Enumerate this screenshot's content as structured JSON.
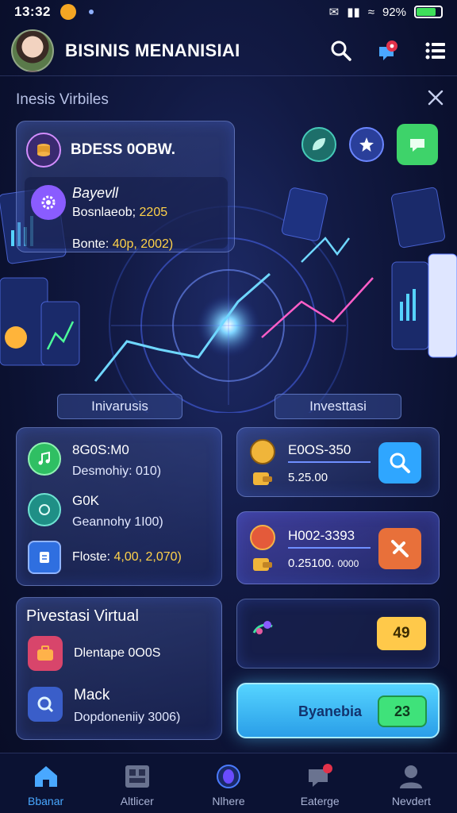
{
  "status_bar": {
    "time": "13:32",
    "battery": "92%"
  },
  "header": {
    "title": "BISINIS MENANISIAI"
  },
  "subheader": {
    "label": "Inesis Virbiles"
  },
  "top_card": {
    "title": "BDESS 0OBW.",
    "name": "Bayevll",
    "line1_prefix": "Bosnlaeob;",
    "line1_value": "2205",
    "line2_prefix": "Bonte:",
    "line2_value": "40p, 2002)"
  },
  "pills": {
    "left": "Inivarusis",
    "right": "Investtasi"
  },
  "list_card": {
    "items": [
      {
        "title": "8G0S:M0",
        "sub": "Desmohiy: 010)"
      },
      {
        "title": "G0K",
        "sub": "Geannohy 1I00)"
      },
      {
        "title": "Floste:",
        "sub_value": "4,00, 2,070)"
      }
    ]
  },
  "right_cards": [
    {
      "code": "E0OS-350",
      "value": "5.25.00"
    },
    {
      "code": "H002-3393",
      "value": "0.25100.",
      "value_extra": "0000"
    }
  ],
  "score_card": {
    "value": "49"
  },
  "virtual_card": {
    "title": "Pivestasi Virtual",
    "items": [
      {
        "label": "Dlentape 0O0S"
      },
      {
        "label": "Mack",
        "sub": "Dopdoneniiy 3006)"
      }
    ]
  },
  "cta": {
    "label": "Byanebia",
    "value": "23"
  },
  "bottom_nav": [
    {
      "label": "Bbanar",
      "icon": "home-icon",
      "active": true
    },
    {
      "label": "Altlicer",
      "icon": "grid-icon",
      "active": false
    },
    {
      "label": "Nlhere",
      "icon": "orb-icon",
      "active": false
    },
    {
      "label": "Eaterge",
      "icon": "chat-icon",
      "active": false
    },
    {
      "label": "Nevdert",
      "icon": "user-icon",
      "active": false
    }
  ],
  "colors": {
    "accent": "#49a8ff",
    "gold": "#ffd24a",
    "cta": "#2a9ee8",
    "green": "#3fe27a"
  }
}
